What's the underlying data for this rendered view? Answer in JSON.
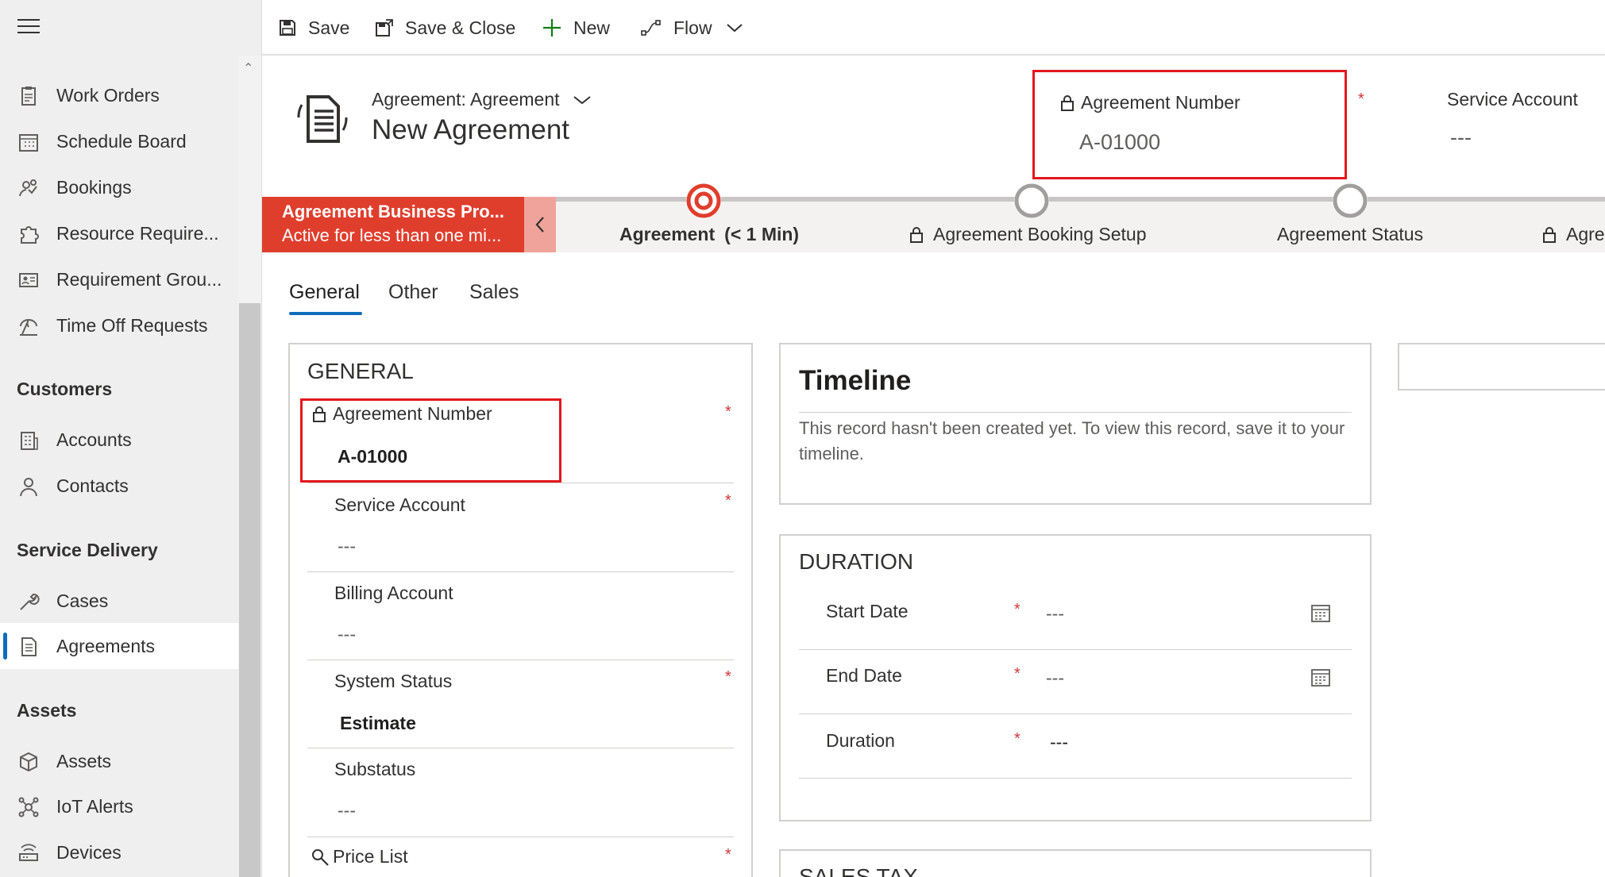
{
  "sidebar": {
    "items": [
      {
        "label": "Work Orders",
        "icon": "clipboard-icon"
      },
      {
        "label": "Schedule Board",
        "icon": "calendar-icon"
      },
      {
        "label": "Bookings",
        "icon": "people-icon"
      },
      {
        "label": "Resource Require...",
        "icon": "puzzle-icon"
      },
      {
        "label": "Requirement Grou...",
        "icon": "contact-card-icon"
      },
      {
        "label": "Time Off Requests",
        "icon": "beach-icon"
      }
    ],
    "groups": {
      "customers": "Customers",
      "service_delivery": "Service Delivery",
      "assets": "Assets"
    },
    "customers_items": [
      {
        "label": "Accounts",
        "icon": "building-icon"
      },
      {
        "label": "Contacts",
        "icon": "person-icon"
      }
    ],
    "service_items": [
      {
        "label": "Cases",
        "icon": "wrench-icon"
      },
      {
        "label": "Agreements",
        "icon": "document-icon"
      }
    ],
    "assets_items": [
      {
        "label": "Assets",
        "icon": "cube-icon"
      },
      {
        "label": "IoT Alerts",
        "icon": "iot-icon"
      },
      {
        "label": "Devices",
        "icon": "router-icon"
      }
    ]
  },
  "toolbar": {
    "save": "Save",
    "save_close": "Save & Close",
    "new": "New",
    "flow": "Flow"
  },
  "header": {
    "form_selector": "Agreement: Agreement",
    "title": "New Agreement",
    "agreement_number_label": "Agreement Number",
    "agreement_number_value": "A-01000",
    "service_account_label": "Service Account",
    "service_account_value": "---",
    "required_marker": "*"
  },
  "bpf": {
    "active_name": "Agreement Business Pro...",
    "active_duration": "Active for less than one mi...",
    "stages": [
      {
        "label": "Agreement",
        "suffix": "(< 1 Min)"
      },
      {
        "label": "Agreement Booking Setup"
      },
      {
        "label": "Agreement Status"
      },
      {
        "label": "Agre"
      }
    ]
  },
  "tabs": [
    "General",
    "Other",
    "Sales"
  ],
  "general": {
    "title": "GENERAL",
    "fields": [
      {
        "label": "Agreement Number",
        "value": "A-01000"
      },
      {
        "label": "Service Account",
        "value": "---"
      },
      {
        "label": "Billing Account",
        "value": "---"
      },
      {
        "label": "System Status",
        "value": "Estimate"
      },
      {
        "label": "Substatus",
        "value": "---"
      },
      {
        "label": "Price List"
      }
    ]
  },
  "timeline": {
    "title": "Timeline",
    "message": "This record hasn't been created yet.  To view this record, save it to your timeline."
  },
  "duration": {
    "title": "DURATION",
    "fields": [
      {
        "label": "Start Date",
        "value": "---"
      },
      {
        "label": "End Date",
        "value": "---"
      },
      {
        "label": "Duration",
        "value": "---"
      }
    ]
  },
  "sales_tax": {
    "title": "SALES TAX"
  },
  "colors": {
    "accent": "#0f6cbd",
    "bpf_active": "#e03e2d",
    "highlight": "#e3171c",
    "required": "#d13438"
  }
}
